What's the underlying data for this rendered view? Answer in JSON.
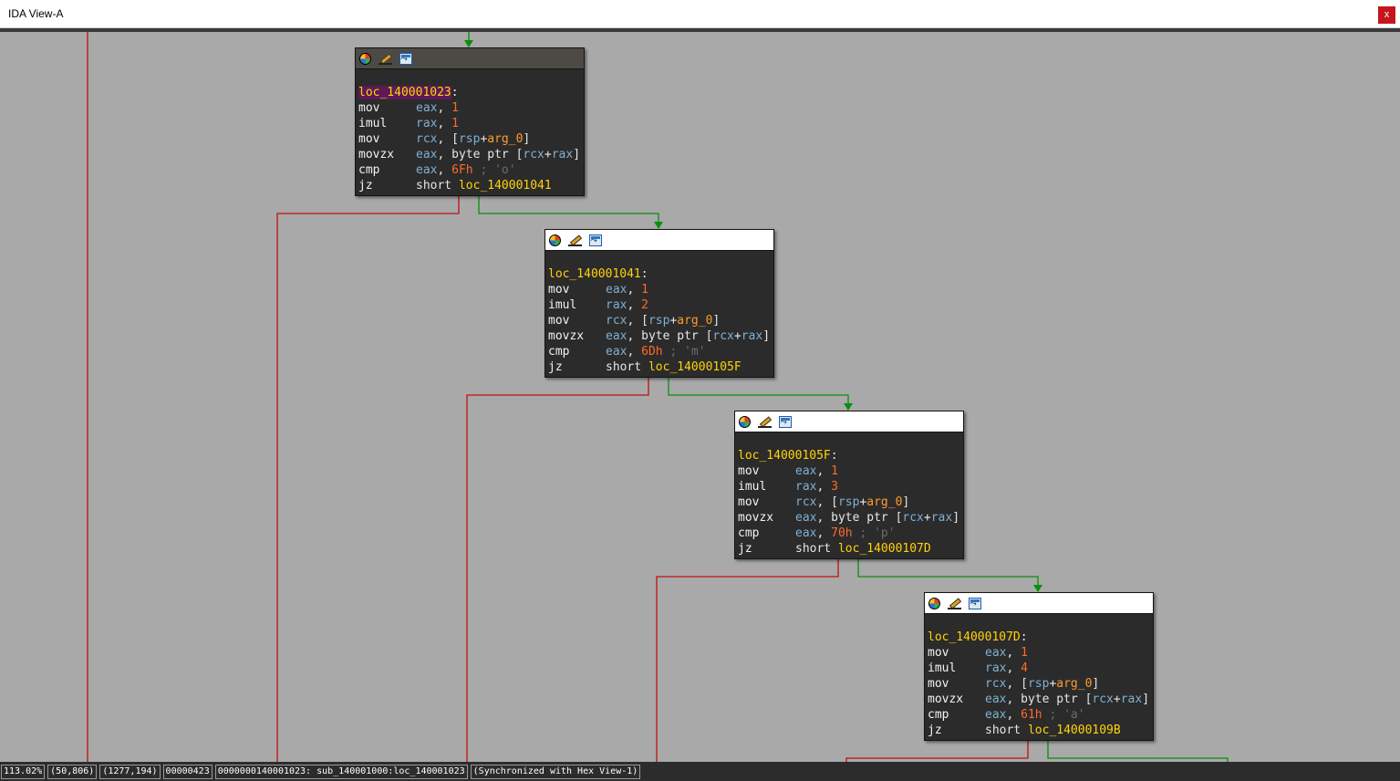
{
  "window": {
    "title": "IDA View-A",
    "close_label": "x"
  },
  "header_icons": [
    "color-palette-icon",
    "rename-pencil-icon",
    "graph-overview-icon"
  ],
  "colors": {
    "graph_background": "#a9a9a9",
    "node_background": "#2b2b2b",
    "label": "#ffd20a",
    "register": "#7fb0d3",
    "immediate": "#ff6a2a",
    "comment": "#6b6b6b",
    "edge_true": "#0a8f0a",
    "edge_false": "#c01010"
  },
  "blocks": [
    {
      "label": "loc_140001023",
      "active": true,
      "lines": [
        {
          "mn": "mov",
          "ops": [
            {
              "t": "eax",
              "c": "reg"
            },
            {
              "t": ", ",
              "c": ""
            },
            {
              "t": "1",
              "c": "num"
            }
          ]
        },
        {
          "mn": "imul",
          "ops": [
            {
              "t": "rax",
              "c": "reg"
            },
            {
              "t": ", ",
              "c": ""
            },
            {
              "t": "1",
              "c": "num"
            }
          ]
        },
        {
          "mn": "mov",
          "ops": [
            {
              "t": "rcx",
              "c": "reg"
            },
            {
              "t": ", [",
              "c": ""
            },
            {
              "t": "rsp",
              "c": "reg"
            },
            {
              "t": "+",
              "c": ""
            },
            {
              "t": "arg_0",
              "c": "argv"
            },
            {
              "t": "]",
              "c": ""
            }
          ]
        },
        {
          "mn": "movzx",
          "ops": [
            {
              "t": "eax",
              "c": "reg"
            },
            {
              "t": ", byte ptr [",
              "c": ""
            },
            {
              "t": "rcx",
              "c": "reg"
            },
            {
              "t": "+",
              "c": ""
            },
            {
              "t": "rax",
              "c": "reg"
            },
            {
              "t": "]",
              "c": ""
            }
          ]
        },
        {
          "mn": "cmp",
          "ops": [
            {
              "t": "eax",
              "c": "reg"
            },
            {
              "t": ", ",
              "c": ""
            },
            {
              "t": "6Fh",
              "c": "num"
            },
            {
              "t": " ; 'o'",
              "c": "cmt"
            }
          ]
        },
        {
          "mn": "jz",
          "ops": [
            {
              "t": "short ",
              "c": ""
            },
            {
              "t": "loc_140001041",
              "c": "code-lbl"
            }
          ]
        }
      ]
    },
    {
      "label": "loc_140001041",
      "active": false,
      "lines": [
        {
          "mn": "mov",
          "ops": [
            {
              "t": "eax",
              "c": "reg"
            },
            {
              "t": ", ",
              "c": ""
            },
            {
              "t": "1",
              "c": "num"
            }
          ]
        },
        {
          "mn": "imul",
          "ops": [
            {
              "t": "rax",
              "c": "reg"
            },
            {
              "t": ", ",
              "c": ""
            },
            {
              "t": "2",
              "c": "num"
            }
          ]
        },
        {
          "mn": "mov",
          "ops": [
            {
              "t": "rcx",
              "c": "reg"
            },
            {
              "t": ", [",
              "c": ""
            },
            {
              "t": "rsp",
              "c": "reg"
            },
            {
              "t": "+",
              "c": ""
            },
            {
              "t": "arg_0",
              "c": "argv"
            },
            {
              "t": "]",
              "c": ""
            }
          ]
        },
        {
          "mn": "movzx",
          "ops": [
            {
              "t": "eax",
              "c": "reg"
            },
            {
              "t": ", byte ptr [",
              "c": ""
            },
            {
              "t": "rcx",
              "c": "reg"
            },
            {
              "t": "+",
              "c": ""
            },
            {
              "t": "rax",
              "c": "reg"
            },
            {
              "t": "]",
              "c": ""
            }
          ]
        },
        {
          "mn": "cmp",
          "ops": [
            {
              "t": "eax",
              "c": "reg"
            },
            {
              "t": ", ",
              "c": ""
            },
            {
              "t": "6Dh",
              "c": "num"
            },
            {
              "t": " ; 'm'",
              "c": "cmt"
            }
          ]
        },
        {
          "mn": "jz",
          "ops": [
            {
              "t": "short ",
              "c": ""
            },
            {
              "t": "loc_14000105F",
              "c": "code-lbl"
            }
          ]
        }
      ]
    },
    {
      "label": "loc_14000105F",
      "active": false,
      "lines": [
        {
          "mn": "mov",
          "ops": [
            {
              "t": "eax",
              "c": "reg"
            },
            {
              "t": ", ",
              "c": ""
            },
            {
              "t": "1",
              "c": "num"
            }
          ]
        },
        {
          "mn": "imul",
          "ops": [
            {
              "t": "rax",
              "c": "reg"
            },
            {
              "t": ", ",
              "c": ""
            },
            {
              "t": "3",
              "c": "num"
            }
          ]
        },
        {
          "mn": "mov",
          "ops": [
            {
              "t": "rcx",
              "c": "reg"
            },
            {
              "t": ", [",
              "c": ""
            },
            {
              "t": "rsp",
              "c": "reg"
            },
            {
              "t": "+",
              "c": ""
            },
            {
              "t": "arg_0",
              "c": "argv"
            },
            {
              "t": "]",
              "c": ""
            }
          ]
        },
        {
          "mn": "movzx",
          "ops": [
            {
              "t": "eax",
              "c": "reg"
            },
            {
              "t": ", byte ptr [",
              "c": ""
            },
            {
              "t": "rcx",
              "c": "reg"
            },
            {
              "t": "+",
              "c": ""
            },
            {
              "t": "rax",
              "c": "reg"
            },
            {
              "t": "]",
              "c": ""
            }
          ]
        },
        {
          "mn": "cmp",
          "ops": [
            {
              "t": "eax",
              "c": "reg"
            },
            {
              "t": ", ",
              "c": ""
            },
            {
              "t": "70h",
              "c": "num"
            },
            {
              "t": " ; 'p'",
              "c": "cmt"
            }
          ]
        },
        {
          "mn": "jz",
          "ops": [
            {
              "t": "short ",
              "c": ""
            },
            {
              "t": "loc_14000107D",
              "c": "code-lbl"
            }
          ]
        }
      ]
    },
    {
      "label": "loc_14000107D",
      "active": false,
      "lines": [
        {
          "mn": "mov",
          "ops": [
            {
              "t": "eax",
              "c": "reg"
            },
            {
              "t": ", ",
              "c": ""
            },
            {
              "t": "1",
              "c": "num"
            }
          ]
        },
        {
          "mn": "imul",
          "ops": [
            {
              "t": "rax",
              "c": "reg"
            },
            {
              "t": ", ",
              "c": ""
            },
            {
              "t": "4",
              "c": "num"
            }
          ]
        },
        {
          "mn": "mov",
          "ops": [
            {
              "t": "rcx",
              "c": "reg"
            },
            {
              "t": ", [",
              "c": ""
            },
            {
              "t": "rsp",
              "c": "reg"
            },
            {
              "t": "+",
              "c": ""
            },
            {
              "t": "arg_0",
              "c": "argv"
            },
            {
              "t": "]",
              "c": ""
            }
          ]
        },
        {
          "mn": "movzx",
          "ops": [
            {
              "t": "eax",
              "c": "reg"
            },
            {
              "t": ", byte ptr [",
              "c": ""
            },
            {
              "t": "rcx",
              "c": "reg"
            },
            {
              "t": "+",
              "c": ""
            },
            {
              "t": "rax",
              "c": "reg"
            },
            {
              "t": "]",
              "c": ""
            }
          ]
        },
        {
          "mn": "cmp",
          "ops": [
            {
              "t": "eax",
              "c": "reg"
            },
            {
              "t": ", ",
              "c": ""
            },
            {
              "t": "61h",
              "c": "num"
            },
            {
              "t": " ; 'a'",
              "c": "cmt"
            }
          ]
        },
        {
          "mn": "jz",
          "ops": [
            {
              "t": "short ",
              "c": ""
            },
            {
              "t": "loc_14000109B",
              "c": "code-lbl"
            }
          ]
        }
      ]
    }
  ],
  "status": {
    "zoom": "113.02%",
    "graph_pos": "(50,806)",
    "mouse_pos": "(1277,194)",
    "file_offset": "00000423",
    "location": "0000000140001023: sub_140001000:loc_140001023",
    "sync": "(Synchronized with Hex View-1)"
  }
}
